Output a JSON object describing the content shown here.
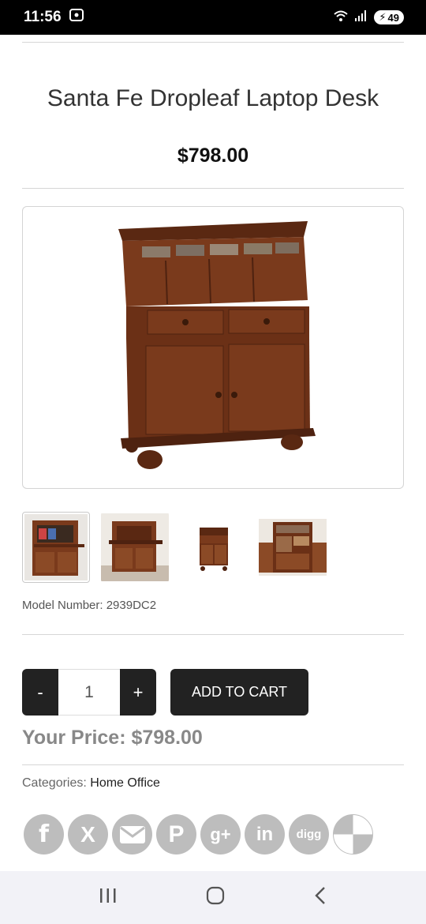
{
  "status_bar": {
    "time": "11:56",
    "battery": "49"
  },
  "product": {
    "title": "Santa Fe Dropleaf Laptop Desk",
    "price": "$798.00",
    "model_label": "Model Number: 2939DC2",
    "your_price": "Your Price: $798.00"
  },
  "cart": {
    "minus_label": "-",
    "plus_label": "+",
    "quantity": "1",
    "add_label": "ADD TO CART"
  },
  "categories": {
    "label": "Categories: ",
    "value": "Home Office"
  },
  "social": [
    "f",
    "X",
    "mail",
    "P",
    "g+",
    "in",
    "digg",
    "share"
  ],
  "colors": {
    "wood": "#7a3a1c",
    "wood_dark": "#4e2210",
    "button": "#222222",
    "icon_gray": "#bdbdbd"
  }
}
